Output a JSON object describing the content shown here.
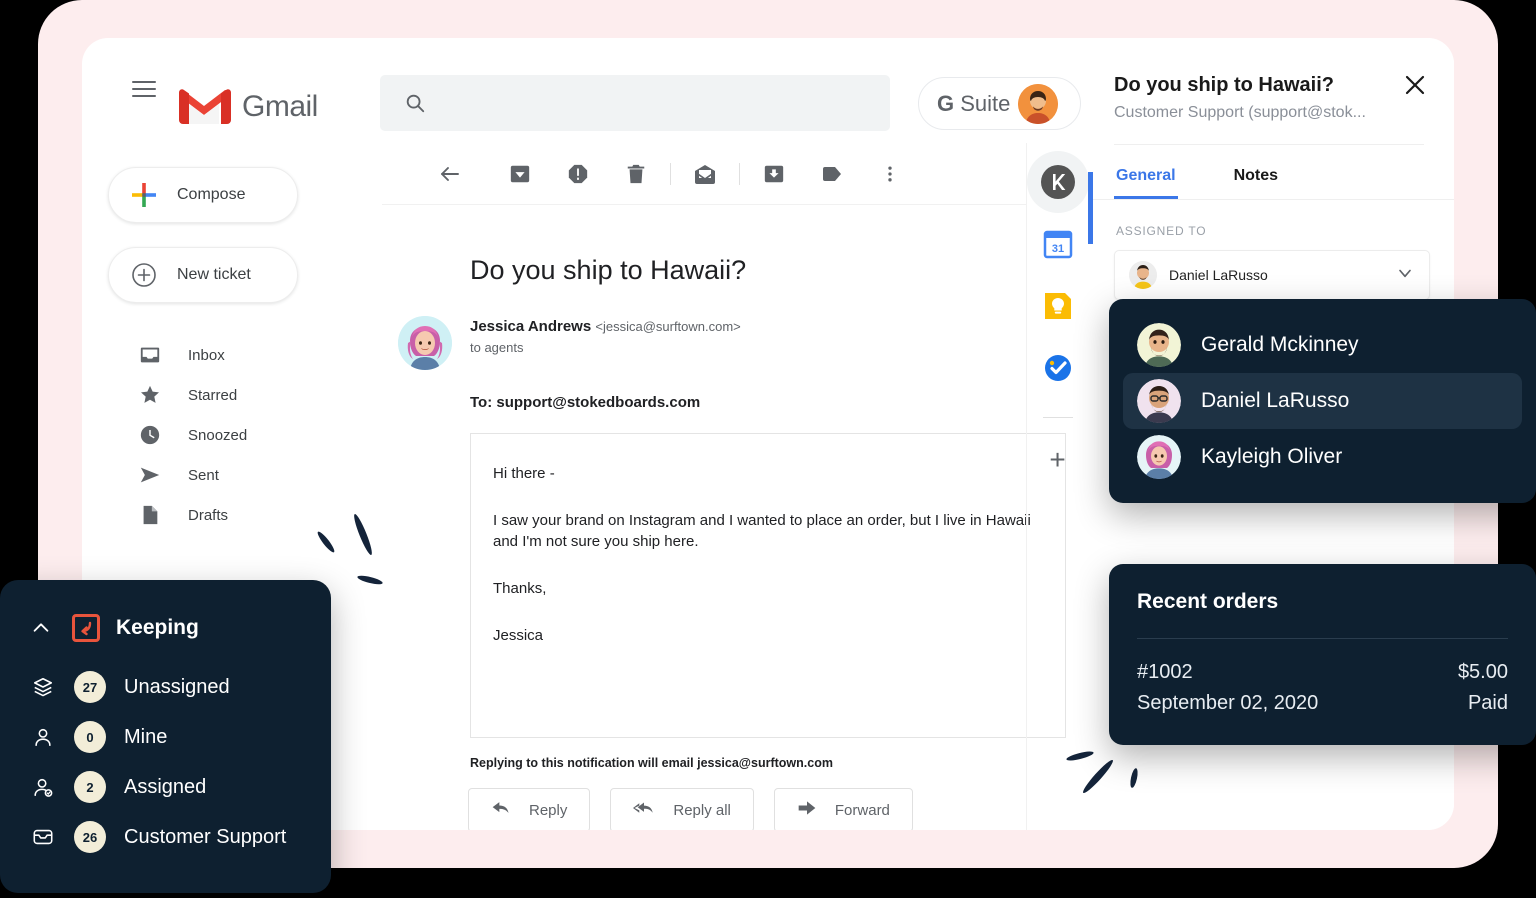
{
  "theme": {
    "page_bg": "#000000",
    "backdrop_pink": "#FDEDEE",
    "window_white": "#FFFFFF",
    "dark_card": "#0E2030",
    "dark_card_selected": "#1E3244",
    "accent_blue": "#3B77E8",
    "keeping_orange": "#E8543C",
    "badge_cream": "#F2EDD8"
  },
  "gmail": {
    "brand": "Gmail",
    "menu_icon": "hamburger-icon",
    "logo_icon": "gmail-logo-icon",
    "search": {
      "placeholder": "",
      "value": "",
      "icon": "search-icon"
    },
    "gsuite": {
      "g_letter": "G",
      "label": " Suite",
      "avatar": "user-avatar"
    }
  },
  "sidebar": {
    "compose": {
      "label": "Compose",
      "icon": "plus-colored-icon"
    },
    "new_ticket": {
      "label": "New ticket",
      "icon": "plus-circle-icon"
    },
    "items": [
      {
        "label": "Inbox",
        "icon": "inbox-icon"
      },
      {
        "label": "Starred",
        "icon": "star-icon"
      },
      {
        "label": "Snoozed",
        "icon": "clock-icon"
      },
      {
        "label": "Sent",
        "icon": "send-icon"
      },
      {
        "label": "Drafts",
        "icon": "draft-icon"
      }
    ]
  },
  "toolbar": {
    "buttons": [
      {
        "name": "back-icon",
        "title": "Back"
      },
      {
        "name": "archive-icon",
        "title": "Archive"
      },
      {
        "name": "report-spam-icon",
        "title": "Report spam"
      },
      {
        "name": "delete-icon",
        "title": "Delete"
      },
      {
        "name": "mark-unread-icon",
        "title": "Mark as unread"
      },
      {
        "name": "snooze-icon",
        "title": "Move to inbox"
      },
      {
        "name": "label-icon",
        "title": "Labels"
      },
      {
        "name": "more-options-icon",
        "title": "More"
      }
    ]
  },
  "email": {
    "subject": "Do you ship to Hawaii?",
    "sender_name": "Jessica Andrews",
    "sender_email": "<jessica@surftown.com>",
    "to_line": "to agents",
    "recipient": "To: support@stokedboards.com",
    "body": [
      "Hi there -",
      "I saw your brand on Instagram and I wanted to place an order, but I live in Hawaii and I'm not sure you ship here.",
      "Thanks,",
      "Jessica"
    ],
    "reply_note": "Replying to this notification will email jessica@surftown.com",
    "actions": [
      {
        "label": "Reply",
        "icon": "reply-icon"
      },
      {
        "label": "Reply all",
        "icon": "reply-all-icon"
      },
      {
        "label": "Forward",
        "icon": "forward-icon"
      }
    ]
  },
  "addons": [
    {
      "name": "keeping-addon-icon",
      "label": "Keeping",
      "active": true
    },
    {
      "name": "google-calendar-icon",
      "label": "Calendar",
      "active": false
    },
    {
      "name": "google-keep-icon",
      "label": "Keep",
      "active": false
    },
    {
      "name": "google-tasks-icon",
      "label": "Tasks",
      "active": false
    }
  ],
  "addon_plus": "+",
  "ticket_panel": {
    "title": "Do you ship to Hawaii?",
    "subtitle": "Customer Support (support@stok...",
    "close_icon": "close-icon",
    "tabs": [
      {
        "label": "General",
        "active": true
      },
      {
        "label": "Notes",
        "active": false
      }
    ],
    "assigned_label": "ASSIGNED TO",
    "assigned_value": "Daniel LaRusso",
    "assigned_chevron": "chevron-down-icon"
  },
  "agent_dropdown": {
    "options": [
      {
        "name": "Gerald Mckinney",
        "selected": false,
        "avatar_bg": "#F2F4D6"
      },
      {
        "name": "Daniel LaRusso",
        "selected": true,
        "avatar_bg": "#F0E2EE"
      },
      {
        "name": "Kayleigh Oliver",
        "selected": false,
        "avatar_bg": "#E6F4F7"
      }
    ]
  },
  "recent_orders": {
    "title": "Recent orders",
    "rows": [
      {
        "id": "#1002",
        "amount": "$5.00",
        "date": "September 02, 2020",
        "status": "Paid"
      }
    ]
  },
  "keeping": {
    "collapse_icon": "chevron-up-icon",
    "logo_icon": "keeping-logo-icon",
    "name": "Keeping",
    "items": [
      {
        "label": "Unassigned",
        "count": "27",
        "icon": "layers-icon"
      },
      {
        "label": "Mine",
        "count": "0",
        "icon": "person-icon"
      },
      {
        "label": "Assigned",
        "count": "2",
        "icon": "person-check-icon"
      },
      {
        "label": "Customer Support",
        "count": "26",
        "icon": "inbox-tray-icon"
      }
    ]
  }
}
